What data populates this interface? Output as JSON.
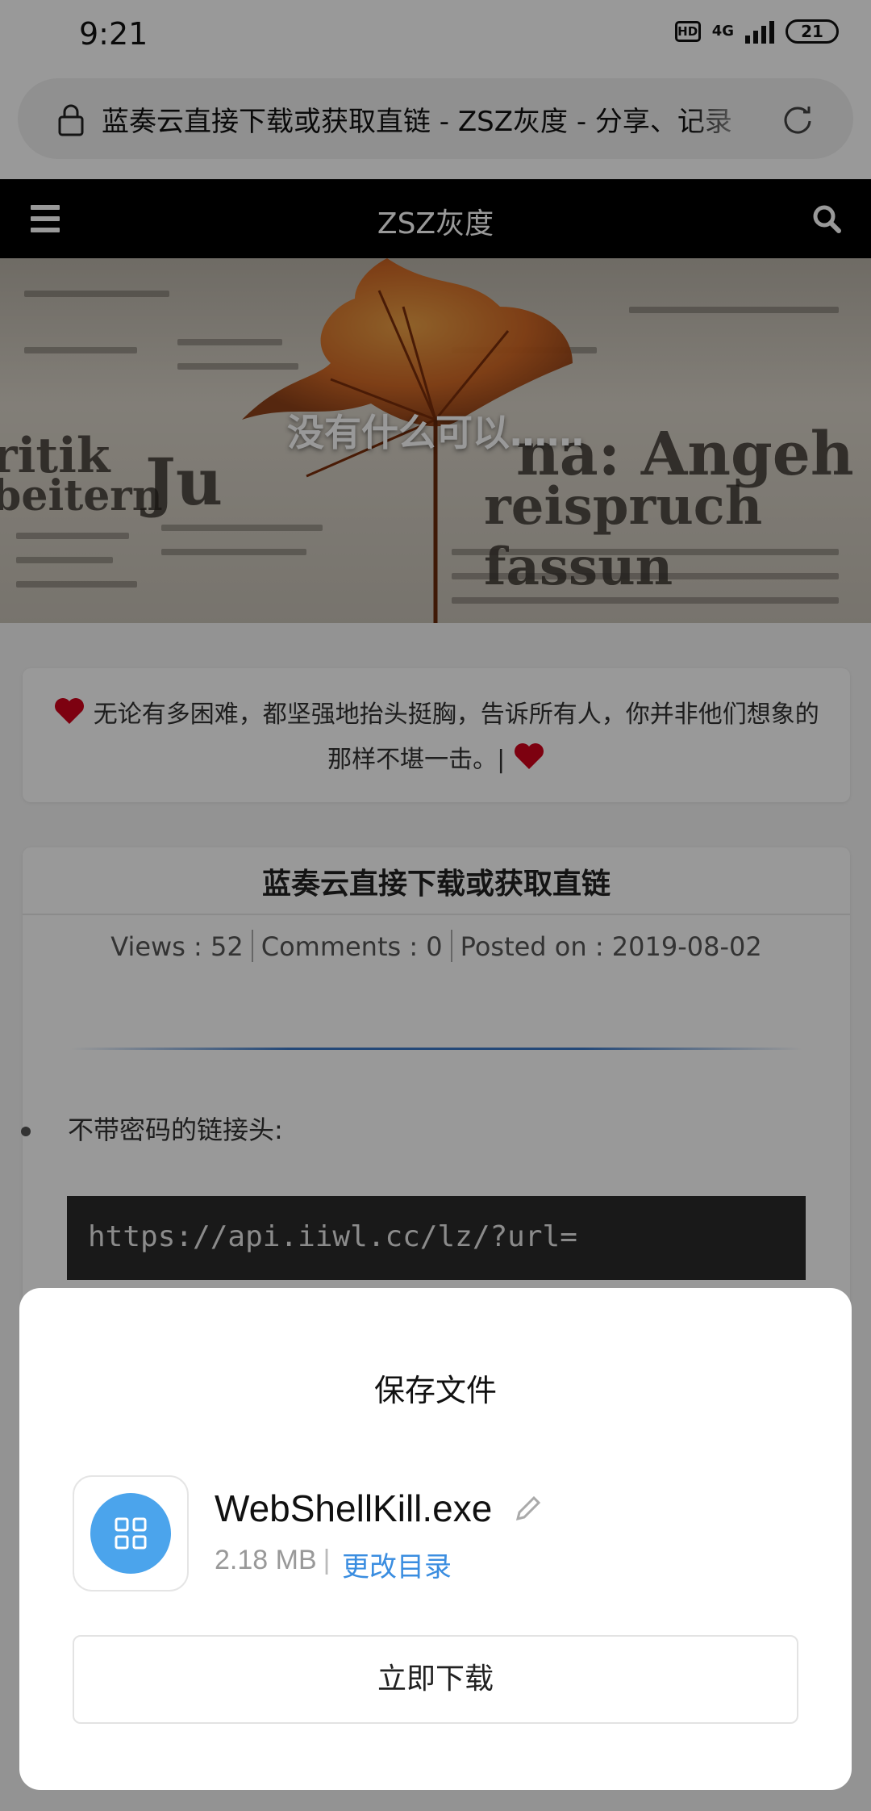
{
  "status_bar": {
    "time": "9:21",
    "hd": "HD",
    "network": "4G",
    "battery": "21"
  },
  "browser": {
    "url_title": "蓝奏云直接下载或获取直链 - ZSZ灰度 - 分享、记录"
  },
  "site": {
    "name": "ZSZ灰度"
  },
  "hero": {
    "title": "没有什么可以……"
  },
  "quote": {
    "text": "无论有多困难，都坚强地抬头挺胸，告诉所有人，你并非他们想象的那样不堪一击。|"
  },
  "article": {
    "title": "蓝奏云直接下载或获取直链",
    "views": "Views : 52",
    "comments": "Comments : 0",
    "posted": "Posted on : 2019-08-02",
    "bullet": "不带密码的链接头:",
    "code": "https://api.iiwl.cc/lz/?url="
  },
  "save_dialog": {
    "title": "保存文件",
    "file_name": "WebShellKill.exe",
    "file_size": "2.18 MB",
    "separator": "|",
    "change_dir": "更改目录",
    "download_label": "立即下载"
  },
  "colors": {
    "accent": "#3a8de0",
    "icon_blue": "#4ba4ec",
    "heart": "#d0021b",
    "header_bg": "#000000"
  }
}
